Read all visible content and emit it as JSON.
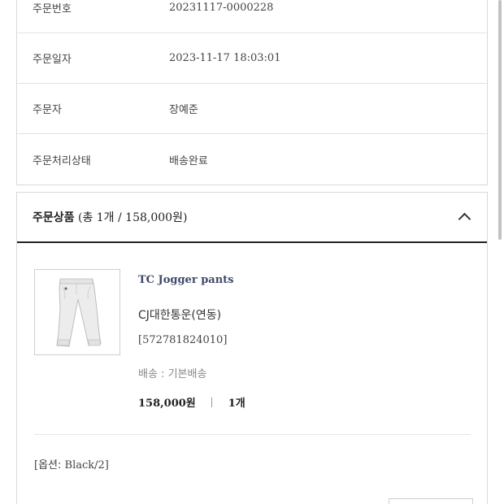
{
  "order_info": {
    "rows": [
      {
        "label": "주문번호",
        "value": "20231117-0000228"
      },
      {
        "label": "주문일자",
        "value": "2023-11-17 18:03:01"
      },
      {
        "label": "주문자",
        "value": "장예준"
      },
      {
        "label": "주문처리상태",
        "value": "배송완료"
      }
    ]
  },
  "products": {
    "title": "주문상품",
    "summary": "(총 1개 / 158,000원)",
    "item": {
      "name": "TC Jogger pants",
      "carrier": "CJ대한통운(연동)",
      "tracking_number": "[572781824010]",
      "shipping": "배송 : 기본배송",
      "price": "158,000원",
      "quantity": "1개",
      "option_label": "[옵션:",
      "option_value": "Black/2]"
    }
  },
  "icons": {
    "collapse": "chevron-up-icon",
    "product_image": "jogger-pants-image"
  }
}
